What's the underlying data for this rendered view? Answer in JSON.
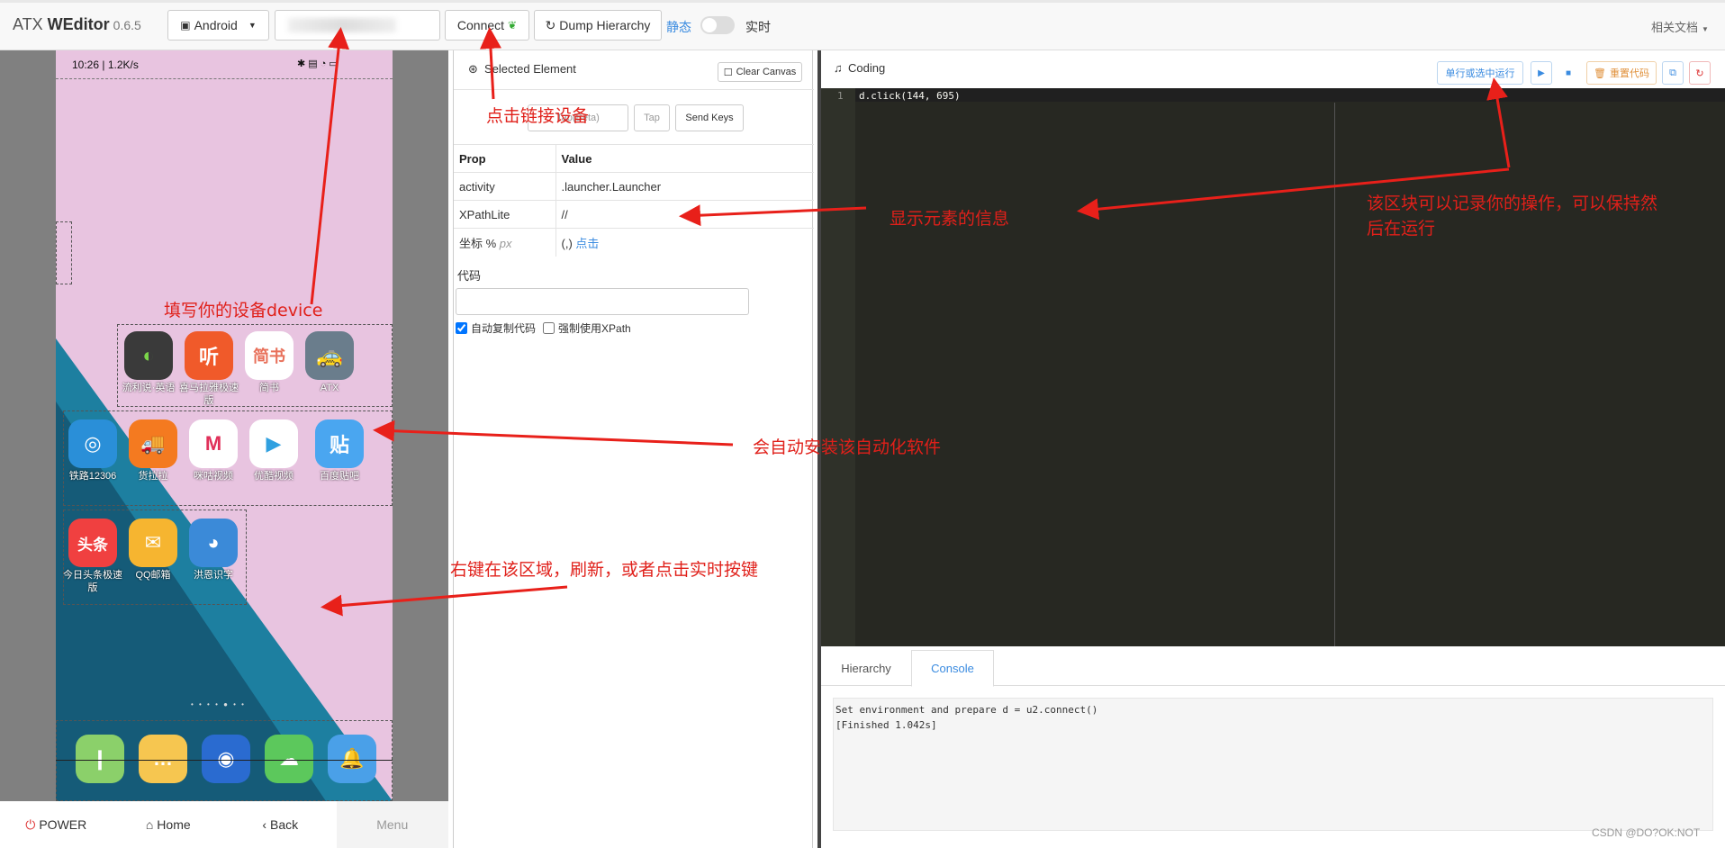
{
  "app": {
    "brand_light": "ATX ",
    "brand_bold": "WEditor",
    "version": "0.6.5"
  },
  "toolbar": {
    "platform": "Android",
    "device_input_value": "",
    "connect_label": "Connect",
    "dump_label": "Dump Hierarchy",
    "mode_static": "静态",
    "mode_realtime": "实时",
    "docs_label": "相关文档"
  },
  "phone": {
    "status_left": "10:26 | 1.2K/s",
    "apps_row1": [
      {
        "label": "流利说·英语",
        "icon": "◐",
        "color": "#3a3a3a"
      },
      {
        "label": "喜马拉雅极速版",
        "icon": "听",
        "color": "#f05a2a"
      },
      {
        "label": "简书",
        "icon": "简书",
        "color": "#ffffff"
      },
      {
        "label": "ATX",
        "icon": "🚕",
        "color": "#6a7d8c"
      }
    ],
    "apps_row2": [
      {
        "label": "铁路12306",
        "icon": "◎",
        "color": "#2a8fd8"
      },
      {
        "label": "货拉拉",
        "icon": "🚚",
        "color": "#f47a20"
      },
      {
        "label": "咪咕视频",
        "icon": "M",
        "color": "#ffffff"
      },
      {
        "label": "优酷视频",
        "icon": "▶",
        "color": "#ffffff"
      },
      {
        "label": "百度贴吧",
        "icon": "贴",
        "color": "#4aa6f0"
      }
    ],
    "apps_row3": [
      {
        "label": "今日头条极速版",
        "icon": "头条",
        "color": "#f04040"
      },
      {
        "label": "QQ邮箱",
        "icon": "✉",
        "color": "#f6b530"
      },
      {
        "label": "洪恩识字",
        "icon": "◕",
        "color": "#3b8ad8"
      }
    ],
    "dock": [
      {
        "icon": "❙",
        "color": "#8bd06a"
      },
      {
        "icon": "…",
        "color": "#f6c650"
      },
      {
        "icon": "◉",
        "color": "#2a6bd0"
      },
      {
        "icon": "☁",
        "color": "#5cc85c"
      },
      {
        "icon": "🔔",
        "color": "#4aa0e8"
      }
    ],
    "bottom": {
      "power": "POWER",
      "home": "Home",
      "back": "Back",
      "menu": "Menu"
    }
  },
  "inspector": {
    "header": "Selected Element",
    "clear_canvas": "Clear Canvas",
    "actions": [
      "Tap(Beta)",
      "Tap",
      "Send Keys"
    ],
    "table_head": [
      "Prop",
      "Value"
    ],
    "rows": [
      {
        "prop": "activity",
        "value": ".launcher.Launcher"
      },
      {
        "prop": "XPathLite",
        "value": "//"
      },
      {
        "prop": "坐标 % ",
        "prop_sub": "px",
        "value": "(,) ",
        "value_link": "点击"
      }
    ],
    "code_label": "代码",
    "auto_copy": "自动复制代码",
    "force_xpath": "强制使用XPath"
  },
  "coding": {
    "title": "Coding",
    "run_selected": "单行或选中运行",
    "reset_code": "重置代码",
    "line_no": "1",
    "code_line": "d.click(144, 695)",
    "tabs": [
      "Hierarchy",
      "Console"
    ],
    "console": [
      "Set environment and prepare d = u2.connect()",
      "[Finished 1.042s]"
    ]
  },
  "annotations": {
    "a1": "点击链接设备",
    "a2": "显示元素的信息",
    "a3": "该区块可以记录你的操作，可以保持然后在运行",
    "a3_l1": "该区块可以记录你的操作，可以保持然",
    "a3_l2": "后在运行",
    "a4": "填写你的设备device",
    "a5": "会自动安装该自动化软件",
    "a6": "右键在该区域，刷新，或者点击实时按键"
  },
  "watermark": "CSDN @DO?OK:NOT"
}
